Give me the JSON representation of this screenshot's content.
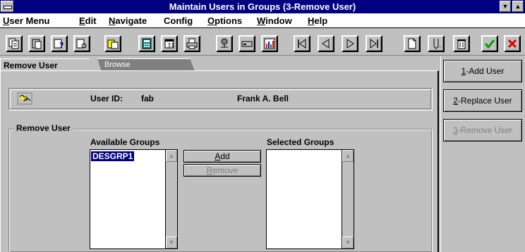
{
  "window": {
    "title": "Maintain Users in Groups (3-Remove User)"
  },
  "menu": [
    {
      "key": "U",
      "rest": "ser Menu"
    },
    {
      "key": "E",
      "rest": "dit"
    },
    {
      "key": "N",
      "rest": "avigate"
    },
    {
      "key": "",
      "rest": "Config"
    },
    {
      "key": "O",
      "rest": "ptions"
    },
    {
      "key": "W",
      "rest": "indow"
    },
    {
      "key": "H",
      "rest": "elp"
    }
  ],
  "toolbar": {
    "icons": [
      "copy-icon",
      "paste-icon",
      "query-icon",
      "find-icon",
      "clipboard-icon",
      "calculator-icon",
      "calendar-icon",
      "print-icon",
      "network-icon",
      "drive-icon",
      "chart-icon",
      "first-record-icon",
      "prev-record-icon",
      "next-record-icon",
      "last-record-icon",
      "new-record-icon",
      "drill-down-icon",
      "delete-icon",
      "accept-icon",
      "cancel-icon"
    ]
  },
  "tabs": {
    "active": "Remove User",
    "other": "Browse"
  },
  "user": {
    "id_label": "User ID:",
    "id_value": "fab",
    "name": "Frank A. Bell"
  },
  "remove_section": {
    "legend": "Remove User",
    "available_label": "Available Groups",
    "selected_label": "Selected Groups",
    "available_items": [
      "DESGRP1"
    ],
    "selected_items": [],
    "add_key": "A",
    "add_rest": "dd",
    "remove_key": "R",
    "remove_rest": "emove"
  },
  "actions": [
    {
      "key": "1",
      "rest": "-Add User",
      "enabled": true
    },
    {
      "key": "2",
      "rest": "-Replace User",
      "enabled": true
    },
    {
      "key": "3",
      "rest": "-Remove User",
      "enabled": false
    }
  ],
  "colors": {
    "title_bar": "#000080",
    "face": "#c0c0c0",
    "selection": "#000080",
    "accept": "#00a000",
    "cancel": "#e00000"
  }
}
